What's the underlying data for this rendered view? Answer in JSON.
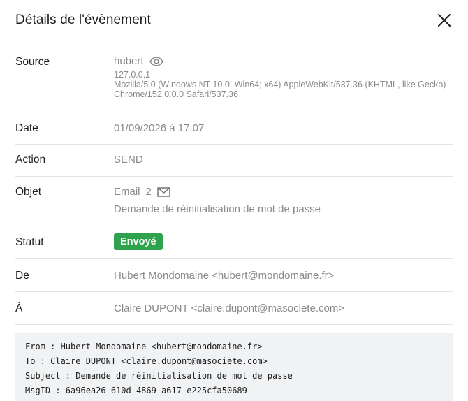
{
  "dialog": {
    "title": "Détails de l'évènement"
  },
  "rows": {
    "source": {
      "label": "Source",
      "user": "hubert",
      "ip": "127.0.0.1",
      "user_agent": "Mozilla/5.0 (Windows NT 10.0; Win64; x64) AppleWebKit/537.36 (KHTML, like Gecko) Chrome/152.0.0.0 Safari/537.36"
    },
    "date": {
      "label": "Date",
      "value": "01/09/2026 à 17:07"
    },
    "action": {
      "label": "Action",
      "value": "SEND"
    },
    "objet": {
      "label": "Objet",
      "type": "Email",
      "count": "2",
      "subject": "Demande de réinitialisation de mot de passe"
    },
    "statut": {
      "label": "Statut",
      "badge": "Envoyé",
      "badge_color": "#2fa24d"
    },
    "de": {
      "label": "De",
      "value": "Hubert Mondomaine <hubert@mondomaine.fr>"
    },
    "a": {
      "label": "À",
      "value": "Claire DUPONT <claire.dupont@masociete.com>"
    }
  },
  "raw": {
    "line1": "From : Hubert Mondomaine <hubert@mondomaine.fr>",
    "line2": "To : Claire DUPONT <claire.dupont@masociete.com>",
    "line3": "Subject : Demande de réinitialisation de mot de passe",
    "line4": "MsgID : 6a96ea26-610d-4869-a617-e225cfa50689"
  },
  "icons": {
    "close": "close-icon",
    "view": "eye-icon",
    "mail": "envelope-icon"
  }
}
